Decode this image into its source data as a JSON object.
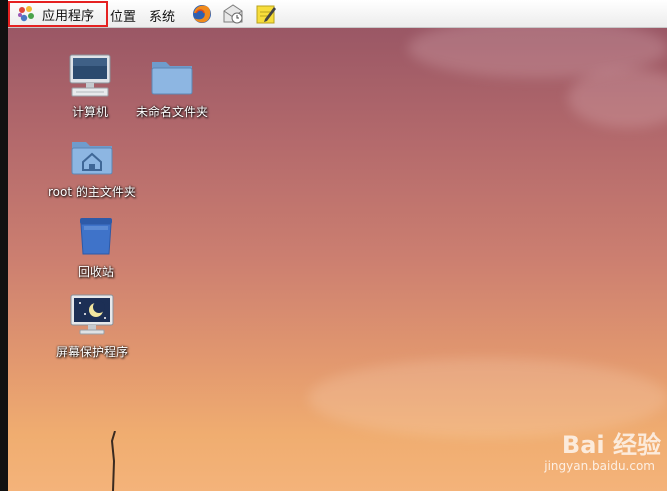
{
  "topbar": {
    "apps_label": "应用程序",
    "places_label": "位置",
    "system_label": "系统",
    "launchers": [
      {
        "icon": "firefox-icon"
      },
      {
        "icon": "mail-clock-icon"
      },
      {
        "icon": "notepad-icon"
      }
    ]
  },
  "desktop": {
    "icons": [
      {
        "label": "计算机",
        "icon": "computer-icon"
      },
      {
        "label": "未命名文件夹",
        "icon": "folder-icon"
      },
      {
        "label": "root 的主文件夹",
        "icon": "home-folder-icon"
      },
      {
        "label": "回收站",
        "icon": "trash-icon"
      },
      {
        "label": "屏幕保护程序",
        "icon": "screensaver-icon"
      }
    ]
  },
  "watermark": {
    "logo": "Bai 经验",
    "url": "jingyan.baidu.com"
  },
  "colors": {
    "highlight": "#e52121",
    "desktop_top": "#9a5765",
    "desktop_bottom": "#f4b37a"
  }
}
